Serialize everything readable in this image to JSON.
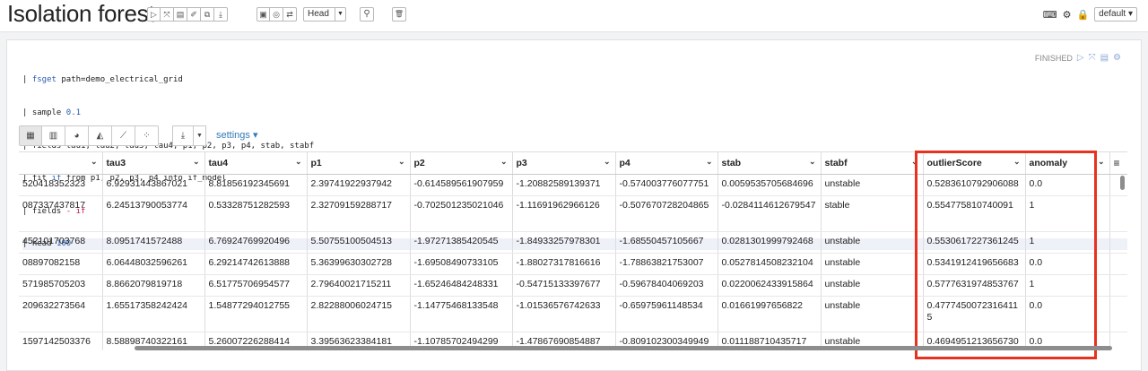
{
  "page": {
    "title": "Isolation forest"
  },
  "toolbar": {
    "run_icons": [
      "play-icon",
      "expand-icon",
      "book-icon",
      "eraser-icon",
      "copy-icon",
      "download-icon"
    ],
    "run_glyphs": [
      "▷",
      "⤧",
      "▤",
      "✐",
      "⧉",
      "⤓"
    ],
    "mid_icons": [
      "report-icon",
      "circle-icon",
      "swap-icon"
    ],
    "mid_glyphs": [
      "▣",
      "◎",
      "⇄"
    ],
    "head_label": "Head",
    "search_glyph": "⚲",
    "trash_glyph": "🗑",
    "default_label": "default"
  },
  "paragraph": {
    "status": "FINISHED",
    "code_lines": [
      "| fsget path=demo_electrical_grid",
      "| sample 0.1",
      "| fields tau1, tau2, tau3, tau4, p1, p2, p3, p4, stab, stabf",
      "| fit if from p1, p2, p3, p4 into if_model",
      "| fields - if",
      "| head 100"
    ],
    "settings_label": "settings"
  },
  "table": {
    "columns": [
      "",
      "tau3",
      "tau4",
      "p1",
      "p2",
      "p3",
      "p4",
      "stab",
      "stabf",
      "outlierScore",
      "anomaly"
    ],
    "rows": [
      [
        "520418352323",
        "6.92931443867021",
        "8.81856192345691",
        "2.39741922937942",
        "-0.614589561907959",
        "-1.20882589139371",
        "-0.574003776077751",
        "0.0059535705684696",
        "unstable",
        "0.5283610792906088",
        "0.0"
      ],
      [
        "087337437817",
        "6.24513790053774",
        "0.53328751282593",
        "2.32709159288717",
        "-0.702501235021046",
        "-1.11691962966126",
        "-0.507670728204865",
        "-0.0284114612679547",
        "stable",
        "0.554775810740091",
        "1"
      ],
      [
        "452101703768",
        "8.0951741572488",
        "6.76924769920496",
        "5.50755100504513",
        "-1.97271385420545",
        "-1.84933257978301",
        "-1.68550457105667",
        "0.0281301999792468",
        "unstable",
        "0.5530617227361245",
        "1"
      ],
      [
        "08897082158",
        "6.06448032596261",
        "6.29214742613888",
        "5.36399630302728",
        "-1.69508490733105",
        "-1.88027317816616",
        "-1.78863821753007",
        "0.0527814508232104",
        "unstable",
        "0.5341912419656683",
        "0.0"
      ],
      [
        "571985705203",
        "8.8662079819718",
        "6.51775706954577",
        "2.79640021715211",
        "-1.65246484248331",
        "-0.54715133397677",
        "-0.59678404069203",
        "0.0220062433915864",
        "unstable",
        "0.5777631974853767",
        "1"
      ],
      [
        "209632273564",
        "1.65517358242424",
        "1.54877294012755",
        "2.82288006024715",
        "-1.14775468133548",
        "-1.01536576742633",
        "-0.65975961148534",
        "0.01661997656822",
        "unstable",
        "0.47774500723164115",
        "0.0"
      ],
      [
        "1597142503376",
        "8.58898740322161",
        "5.26007226288414",
        "3.39563623384181",
        "-1.10785702494299",
        "-1.47867690854887",
        "-0.809102300349949",
        "0.011188710435717",
        "unstable",
        "0.4694951213656730",
        "0.0"
      ]
    ]
  }
}
